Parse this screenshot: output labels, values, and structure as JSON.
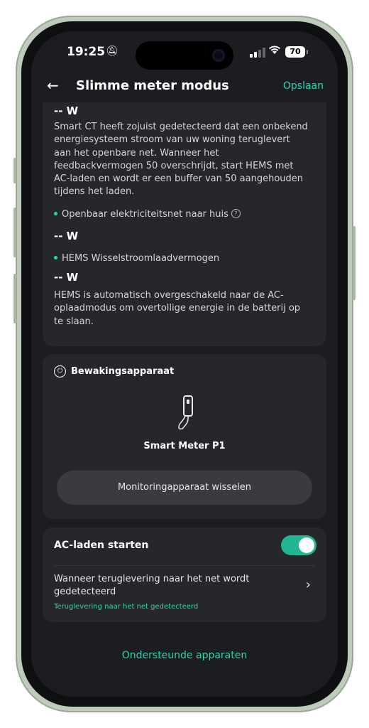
{
  "status_bar": {
    "time": "19:25",
    "battery": "70",
    "mute_icon": "bell-slash-icon",
    "wifi_icon": "wifi-icon"
  },
  "header": {
    "title": "Slimme meter modus",
    "save_label": "Opslaan",
    "back_icon": "arrow-left-icon"
  },
  "energy_card": {
    "value_1": "-- W",
    "paragraph_1": "Smart CT heeft zojuist gedetecteerd dat een onbekend energiesysteem stroom van uw woning teruglevert aan het openbare net. Wanneer het feedbackvermogen 50 overschrijdt, start HEMS met AC-laden en wordt er een buffer van 50 aangehouden tijdens het laden.",
    "bullet_1": "Openbaar elektriciteitsnet naar huis",
    "value_2": "-- W",
    "bullet_2": "HEMS Wisselstroomlaadvermogen",
    "value_3": "-- W",
    "paragraph_2": "HEMS is automatisch overgeschakeld naar de AC-oplaadmodus om overtollige energie in de batterij op te slaan."
  },
  "monitor_card": {
    "title": "Bewakingsapparaat",
    "device_name": "Smart Meter P1",
    "switch_label": "Monitoringapparaat wisselen"
  },
  "ac_card": {
    "title": "AC-laden starten",
    "toggle_on": true,
    "when_label": "Wanneer teruglevering naar het net wordt gedetecteerd",
    "detected_label": "Teruglevering naar het net gedetecteerd"
  },
  "footer": {
    "supported_label": "Ondersteunde apparaten"
  },
  "colors": {
    "accent": "#2bd4ae",
    "toggle": "#22b591",
    "background": "#1c1d21",
    "card": "#26272b"
  }
}
